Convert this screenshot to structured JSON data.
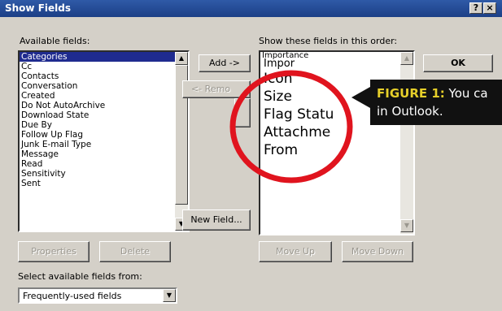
{
  "window": {
    "title": "Show Fields",
    "help_label": "?",
    "close_label": "×"
  },
  "available": {
    "label": "Available fields:",
    "items": [
      "Categories",
      "Cc",
      "Contacts",
      "Conversation",
      "Created",
      "Do Not AutoArchive",
      "Download State",
      "Due By",
      "Follow Up Flag",
      "Junk E-mail Type",
      "Message",
      "Read",
      "Sensitivity",
      "Sent"
    ],
    "selected_index": 0
  },
  "shown": {
    "label": "Show these fields in this order:",
    "small_items": [
      "Importance",
      "Impor"
    ],
    "items": [
      "Icon",
      "Size",
      "Flag Statu",
      "Attachme",
      "From"
    ]
  },
  "buttons": {
    "add": "Add ->",
    "remove": "<- Remo",
    "ok": "OK",
    "new_field": "New Field...",
    "properties": "Properties",
    "delete": "Delete",
    "move_up": "Move Up",
    "move_down": "Move Down"
  },
  "select_from": {
    "label": "Select available fields from:",
    "value": "Frequently-used fields"
  },
  "callout": {
    "bold": "FIGURE 1:",
    "line1_rest": " You ca",
    "line2": "in Outlook."
  },
  "colors": {
    "highlight_circle": "#e0141e",
    "selection": "#1f2b8f",
    "callout_bg": "#111111"
  },
  "icons": {
    "scroll_up": "▲",
    "scroll_down": "▼"
  }
}
